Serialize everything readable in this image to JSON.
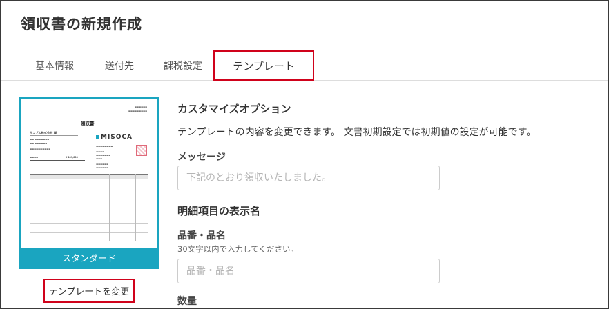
{
  "page": {
    "title": "領収書の新規作成"
  },
  "tabs": [
    {
      "label": "基本情報"
    },
    {
      "label": "送付先"
    },
    {
      "label": "課税設定"
    },
    {
      "label": "テンプレート"
    }
  ],
  "template": {
    "name": "スタンダード",
    "change_button": "テンプレートを変更",
    "preview": {
      "title": "領収書",
      "logo": "MISOCA",
      "recipient": "サンプル株式会社 様",
      "amount": "¥ 249,800"
    }
  },
  "customize": {
    "title": "カスタマイズオプション",
    "description": "テンプレートの内容を変更できます。 文書初期設定では初期値の設定が可能です。",
    "message": {
      "label": "メッセージ",
      "placeholder": "下記のとおり領収いたしました。",
      "value": ""
    }
  },
  "details": {
    "title": "明細項目の表示名",
    "item_name": {
      "label": "品番・品名",
      "hint": "30文字以内で入力してください。",
      "placeholder": "品番・品名",
      "value": ""
    },
    "quantity": {
      "label": "数量"
    }
  },
  "colors": {
    "accent": "#1aa5c0",
    "highlight": "#d0021b"
  }
}
